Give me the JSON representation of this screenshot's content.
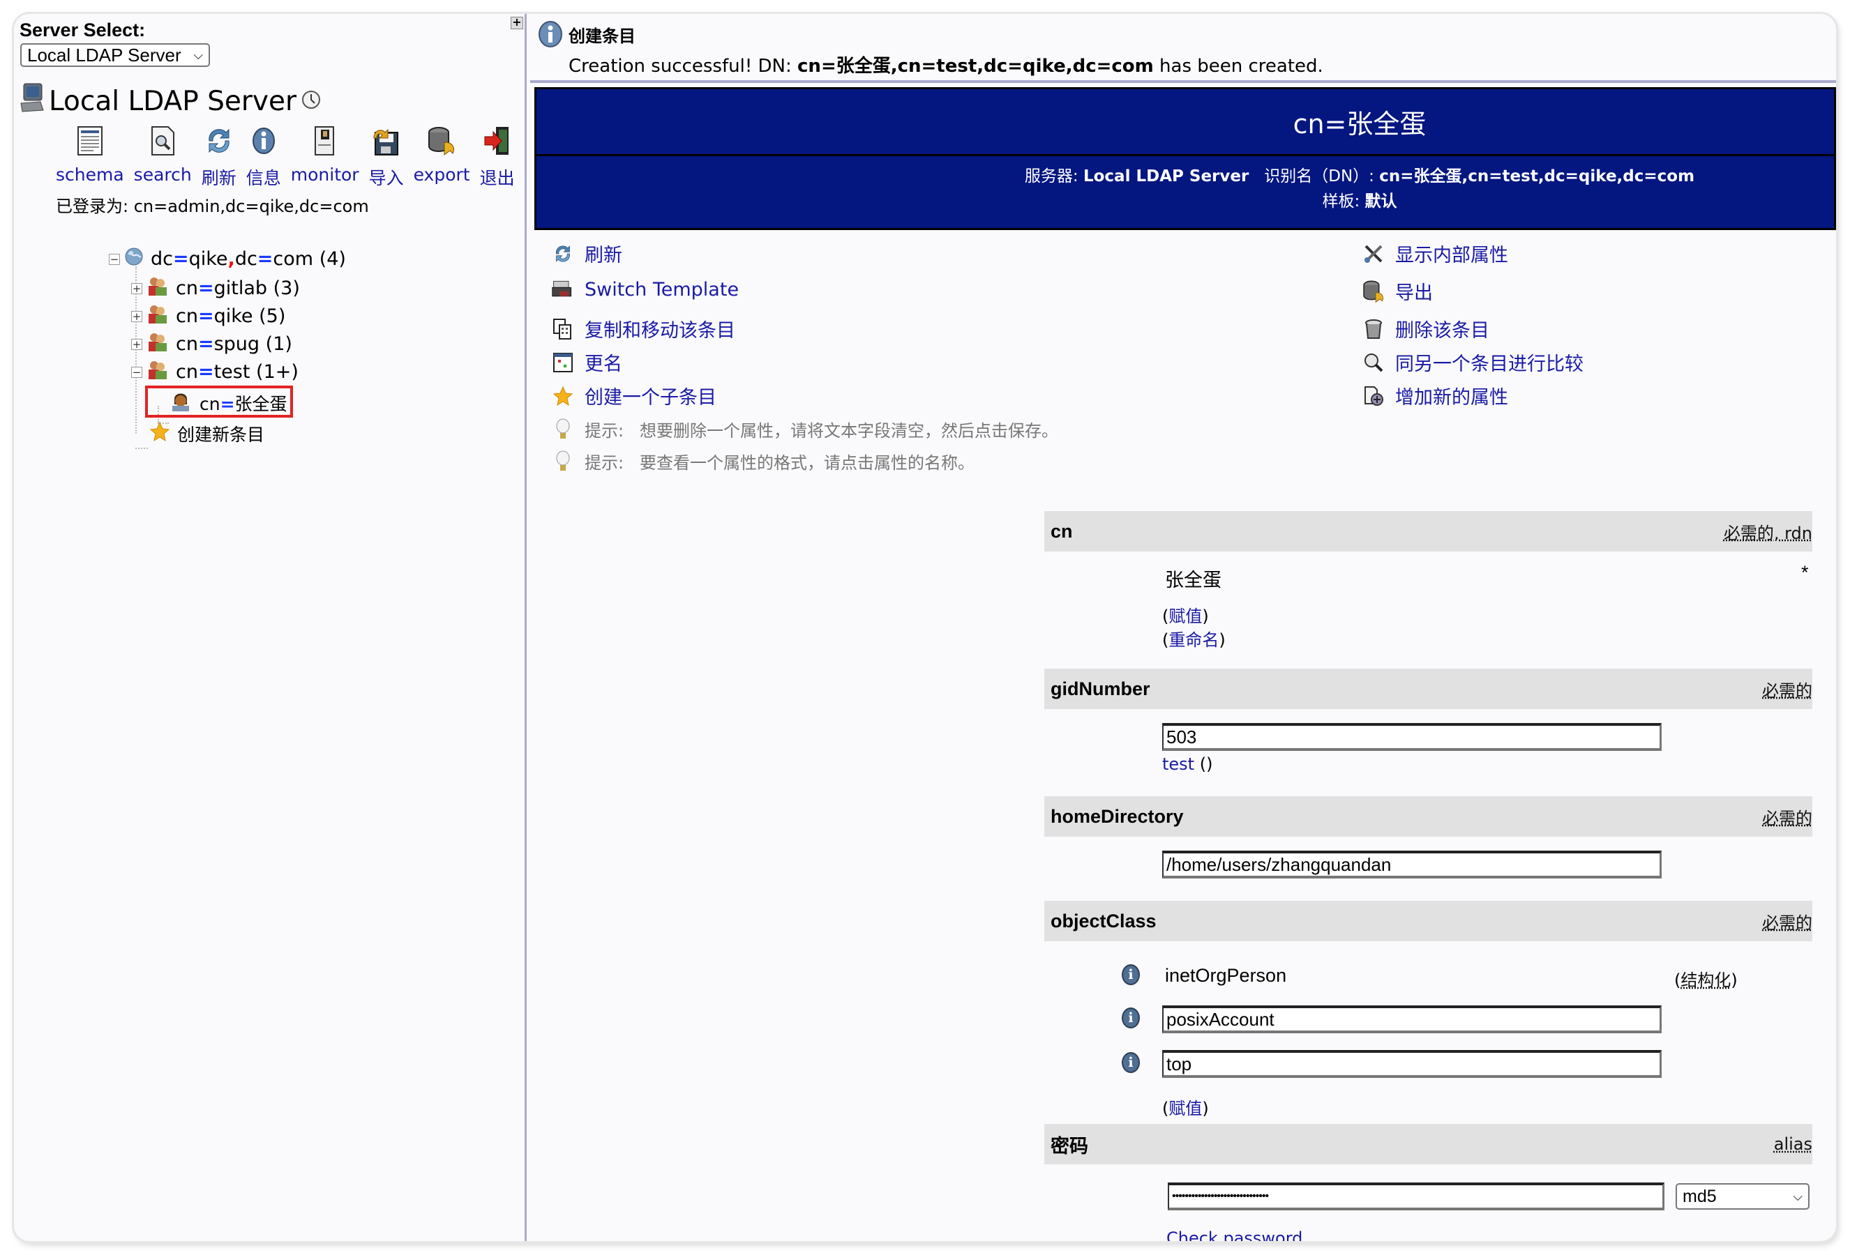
{
  "sidebar": {
    "server_select_label": "Server Select:",
    "server_select_value": "Local LDAP Server",
    "expand_label": "+",
    "server_title": "Local LDAP Server",
    "toolbar": [
      {
        "label": "schema",
        "icon": "schema-icon"
      },
      {
        "label": "search",
        "icon": "search-icon"
      },
      {
        "label": "刷新",
        "icon": "refresh-icon"
      },
      {
        "label": "信息",
        "icon": "info-icon"
      },
      {
        "label": "monitor",
        "icon": "monitor-icon"
      },
      {
        "label": "导入",
        "icon": "import-icon"
      },
      {
        "label": "export",
        "icon": "export-icon"
      },
      {
        "label": "退出",
        "icon": "logout-icon"
      }
    ],
    "logged_in": "已登录为: cn=admin,dc=qike,dc=com",
    "tree": {
      "root": {
        "a": "dc",
        "b": "qike",
        "c": "dc",
        "d": "com",
        "count": "(4)"
      },
      "children": [
        {
          "attr": "cn",
          "name": "gitlab",
          "count": "(3)",
          "toggle": "+"
        },
        {
          "attr": "cn",
          "name": "qike",
          "count": "(5)",
          "toggle": "+"
        },
        {
          "attr": "cn",
          "name": "spug",
          "count": "(1)",
          "toggle": "+"
        },
        {
          "attr": "cn",
          "name": "test",
          "count": "(1+)",
          "toggle": "−"
        }
      ],
      "selected": {
        "attr": "cn",
        "name": "张全蛋"
      },
      "create_new": "创建新条目"
    }
  },
  "message": {
    "title": "创建条目",
    "prefix": "Creation successful! DN: ",
    "dn": "cn=张全蛋,cn=test,dc=qike,dc=com",
    "suffix": " has been created."
  },
  "header": {
    "title": "cn=张全蛋",
    "server_label": "服务器: ",
    "server_value": "Local LDAP Server",
    "dn_label": "识别名（DN）: ",
    "dn_value": "cn=张全蛋,cn=test,dc=qike,dc=com",
    "template_label": "样板: ",
    "template_value": "默认"
  },
  "actions_left": [
    {
      "label": "刷新",
      "icon": "refresh-icon"
    },
    {
      "label": "Switch Template",
      "icon": "switch-template-icon"
    },
    {
      "label": "复制和移动该条目",
      "icon": "copy-move-icon"
    },
    {
      "label": "更名",
      "icon": "rename-icon"
    },
    {
      "label": "创建一个子条目",
      "icon": "star-icon"
    }
  ],
  "actions_right": [
    {
      "label": "显示内部属性",
      "icon": "tools-icon"
    },
    {
      "label": "导出",
      "icon": "export-icon"
    },
    {
      "label": "删除该条目",
      "icon": "trash-icon"
    },
    {
      "label": "同另一个条目进行比较",
      "icon": "compare-icon"
    },
    {
      "label": "增加新的属性",
      "icon": "add-attribute-icon"
    }
  ],
  "hints": [
    {
      "prefix": "提示:",
      "text": "想要删除一个属性，请将文本字段清空，然后点击保存。"
    },
    {
      "prefix": "提示:",
      "text": "要查看一个属性的格式，请点击属性的名称。"
    }
  ],
  "attributes": {
    "cn": {
      "name": "cn",
      "req": "必需的",
      "rdn": "rdn",
      "value": "张全蛋",
      "star": "*",
      "assign": "赋值",
      "rename": "重命名"
    },
    "gidNumber": {
      "name": "gidNumber",
      "req": "必需的",
      "value": "503",
      "link": "test",
      "link_suffix": " ()"
    },
    "homeDirectory": {
      "name": "homeDirectory",
      "req": "必需的",
      "value": "/home/users/zhangquandan"
    },
    "objectClass": {
      "name": "objectClass",
      "req": "必需的",
      "values": [
        "inetOrgPerson",
        "posixAccount",
        "top"
      ],
      "structural": "结构化",
      "assign": "赋值"
    },
    "password": {
      "name": "密码",
      "alias": "alias",
      "value": "••••••••••••••••••••••••••••••",
      "hash": "md5",
      "check": "Check password"
    }
  }
}
